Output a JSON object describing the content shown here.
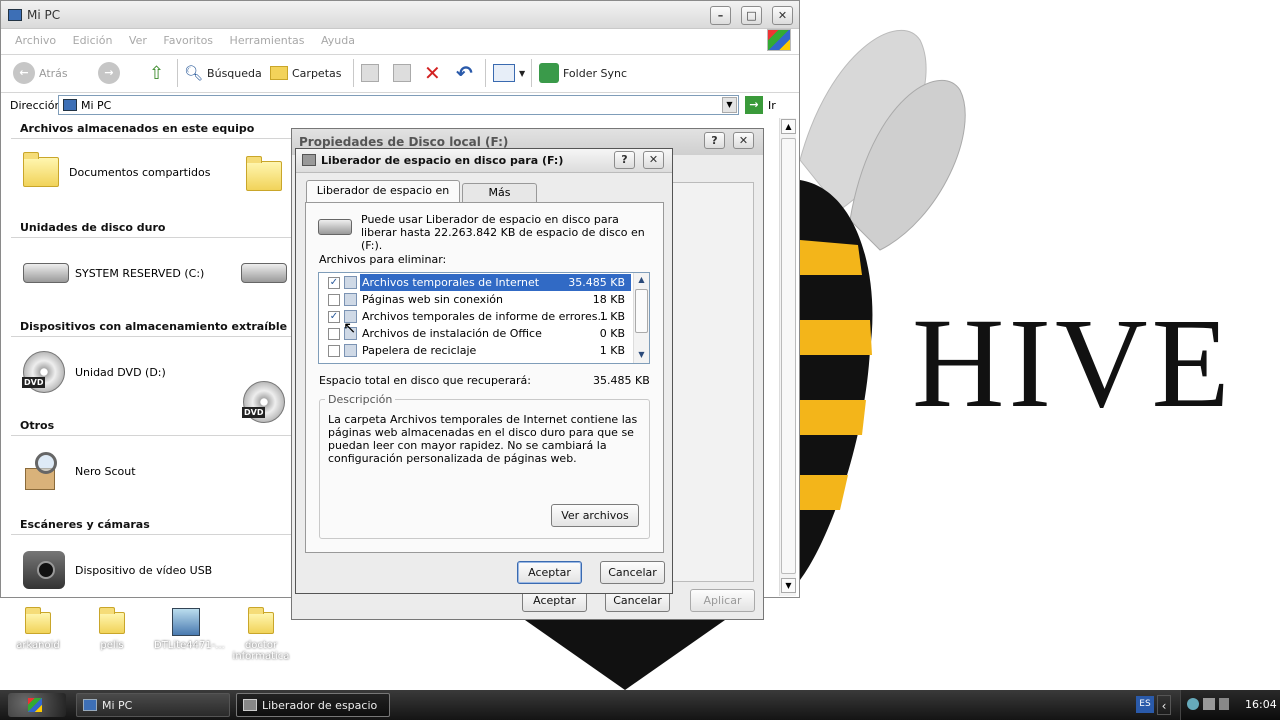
{
  "background": {
    "brand_text": "HIVE"
  },
  "explorer": {
    "title": "Mi PC",
    "menu": [
      "Archivo",
      "Edición",
      "Ver",
      "Favoritos",
      "Herramientas",
      "Ayuda"
    ],
    "toolbar": {
      "back": "Atrás",
      "search": "Búsqueda",
      "folders": "Carpetas",
      "folder_sync": "Folder Sync"
    },
    "address": {
      "label": "Dirección",
      "value": "Mi PC",
      "go": "Ir"
    },
    "sections": [
      {
        "title": "Archivos almacenados en este equipo",
        "items": [
          "Documentos compartidos"
        ]
      },
      {
        "title": "Unidades de disco duro",
        "items": [
          "SYSTEM RESERVED (C:)"
        ]
      },
      {
        "title": "Dispositivos con almacenamiento extraíble",
        "items": [
          "Unidad DVD (D:)"
        ]
      },
      {
        "title": "Otros",
        "items": [
          "Nero Scout"
        ]
      },
      {
        "title": "Escáneres y cámaras",
        "items": [
          "Dispositivo de vídeo USB"
        ]
      }
    ]
  },
  "properties": {
    "title": "Propiedades de Disco local (F:)",
    "buttons": {
      "accept": "Aceptar",
      "cancel": "Cancelar",
      "apply": "Aplicar"
    }
  },
  "cleanup": {
    "title": "Liberador de espacio en disco para  (F:)",
    "tabs": [
      "Liberador de espacio en disco",
      "Más opciones"
    ],
    "intro": "Puede usar Liberador de espacio en disco para liberar hasta 22.263.842 KB de espacio de disco en  (F:).",
    "files_label": "Archivos para eliminar:",
    "files": [
      {
        "name": "Archivos temporales de Internet",
        "size": "35.485 KB",
        "checked": true
      },
      {
        "name": "Páginas web sin conexión",
        "size": "18 KB",
        "checked": false
      },
      {
        "name": "Archivos temporales de informe de errores...",
        "size": "1 KB",
        "checked": true
      },
      {
        "name": "Archivos de instalación de Office",
        "size": "0 KB",
        "checked": false
      },
      {
        "name": "Papelera de reciclaje",
        "size": "1 KB",
        "checked": false
      }
    ],
    "total_label": "Espacio total en disco que recuperará:",
    "total_value": "35.485 KB",
    "description_label": "Descripción",
    "description": "La carpeta Archivos temporales de Internet contiene las páginas web almacenadas en el disco duro para que se puedan leer con mayor rapidez. No se cambiará la configuración personalizada de páginas web.",
    "view_files": "Ver archivos",
    "accept": "Aceptar",
    "cancel": "Cancelar"
  },
  "desktop_icons": [
    "arkanoid",
    "pelis",
    "DTLite4471-...",
    "doctor informatica"
  ],
  "taskbar": {
    "tasks": [
      "Mi PC",
      "Liberador de espacio ..."
    ],
    "lang": "ES",
    "clock": "16:04"
  },
  "colors": {
    "selection": "#316ac5",
    "taskbar": "#1d1d1d"
  }
}
